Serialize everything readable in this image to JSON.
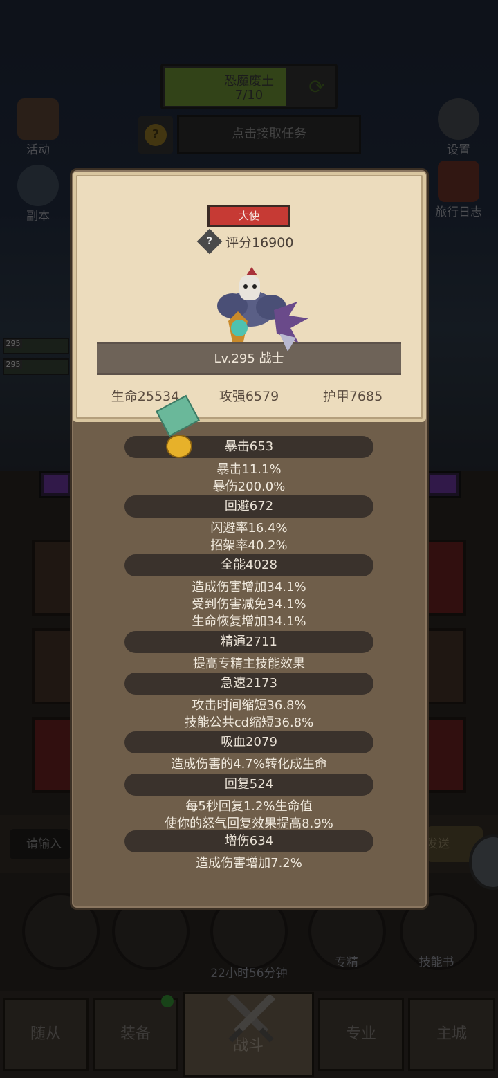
{
  "background": {
    "zone": {
      "name": "恐魔废土",
      "progress": "7/10",
      "progress_fraction": 0.7,
      "refresh_icon": "refresh-icon"
    },
    "quest": {
      "label": "点击接取任务",
      "icon": "coin-question-icon"
    },
    "left_menu": [
      {
        "label": "活动",
        "icon": "activity-icon"
      },
      {
        "label": "副本",
        "icon": "dungeon-icon"
      }
    ],
    "right_menu": [
      {
        "label": "设置",
        "icon": "gear-icon"
      },
      {
        "label": "旅行日志",
        "icon": "journal-icon"
      }
    ],
    "hero_levels": [
      "295",
      "295"
    ],
    "input_placeholder": "请输入",
    "send_label": "发送",
    "timer": "22小时56分钟",
    "bottom_items": [
      {
        "label": "专精",
        "icon": "specialization-icon"
      },
      {
        "label": "技能书",
        "icon": "skillbook-icon"
      }
    ],
    "nav": [
      {
        "label": "随从"
      },
      {
        "label": "装备",
        "badge": true
      },
      {
        "label": "战斗",
        "active": true
      },
      {
        "label": "专业"
      },
      {
        "label": "主城"
      }
    ]
  },
  "modal": {
    "rank": "大使",
    "score": "评分16900",
    "level_class": "Lv.295 战士",
    "main_stats": [
      "生命25534",
      "攻强6579",
      "护甲7685"
    ],
    "sections": [
      {
        "title": "暴击653",
        "lines": [
          "暴击11.1%",
          "暴伤200.0%"
        ]
      },
      {
        "title": "回避672",
        "lines": [
          "闪避率16.4%",
          "招架率40.2%"
        ]
      },
      {
        "title": "全能4028",
        "lines": [
          "造成伤害增加34.1%",
          "受到伤害减免34.1%",
          "生命恢复增加34.1%"
        ]
      },
      {
        "title": "精通2711",
        "lines": [
          "提高专精主技能效果"
        ]
      },
      {
        "title": "急速2173",
        "lines": [
          "攻击时间缩短36.8%",
          "技能公共cd缩短36.8%"
        ]
      },
      {
        "title": "吸血2079",
        "lines": [
          "造成伤害的4.7%转化成生命"
        ]
      },
      {
        "title": "回复524",
        "lines": [
          "每5秒回复1.2%生命值",
          "使你的怒气回复效果提高8.9%"
        ]
      },
      {
        "title": "增伤634",
        "lines": [
          "造成伤害增加7.2%"
        ]
      }
    ]
  }
}
